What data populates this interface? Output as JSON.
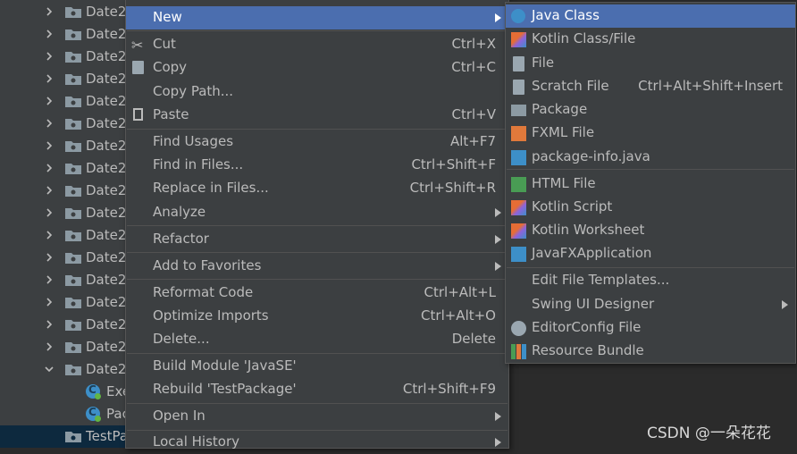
{
  "tree": {
    "rows": [
      {
        "label": "Date2"
      },
      {
        "label": "Date2"
      },
      {
        "label": "Date2"
      },
      {
        "label": "Date2"
      },
      {
        "label": "Date2"
      },
      {
        "label": "Date2"
      },
      {
        "label": "Date2"
      },
      {
        "label": "Date2"
      },
      {
        "label": "Date2"
      },
      {
        "label": "Date2"
      },
      {
        "label": "Date2"
      },
      {
        "label": "Date2"
      },
      {
        "label": "Date2"
      },
      {
        "label": "Date2"
      },
      {
        "label": "Date2"
      },
      {
        "label": "Date2"
      },
      {
        "label": "Date2"
      }
    ],
    "files": [
      {
        "label": "Exe"
      },
      {
        "label": "Pac"
      }
    ],
    "selected_label": "TestPa"
  },
  "main_menu": {
    "new": "New",
    "cut": "Cut",
    "cut_sc": "Ctrl+X",
    "copy": "Copy",
    "copy_sc": "Ctrl+C",
    "copy_path": "Copy Path...",
    "paste": "Paste",
    "paste_sc": "Ctrl+V",
    "find_usages": "Find Usages",
    "find_usages_sc": "Alt+F7",
    "find_in_files": "Find in Files...",
    "find_in_files_sc": "Ctrl+Shift+F",
    "replace_in_files": "Replace in Files...",
    "replace_in_files_sc": "Ctrl+Shift+R",
    "analyze": "Analyze",
    "refactor": "Refactor",
    "add_to_favorites": "Add to Favorites",
    "reformat_code": "Reformat Code",
    "reformat_code_sc": "Ctrl+Alt+L",
    "optimize_imports": "Optimize Imports",
    "optimize_imports_sc": "Ctrl+Alt+O",
    "delete": "Delete...",
    "delete_sc": "Delete",
    "build_module": "Build Module 'JavaSE'",
    "rebuild": "Rebuild 'TestPackage'",
    "rebuild_sc": "Ctrl+Shift+F9",
    "open_in": "Open In",
    "local_history": "Local History"
  },
  "sub_menu": {
    "java_class": "Java Class",
    "kotlin_class": "Kotlin Class/File",
    "file": "File",
    "scratch_file": "Scratch File",
    "scratch_file_sc": "Ctrl+Alt+Shift+Insert",
    "package": "Package",
    "fxml_file": "FXML File",
    "package_info": "package-info.java",
    "html_file": "HTML File",
    "kotlin_script": "Kotlin Script",
    "kotlin_worksheet": "Kotlin Worksheet",
    "javafx_app": "JavaFXApplication",
    "edit_templates": "Edit File Templates...",
    "swing_designer": "Swing UI Designer",
    "editorconfig": "EditorConfig File",
    "resource_bundle": "Resource Bundle"
  },
  "watermark": "CSDN @一朵花花",
  "colors": {
    "highlight": "#4b6eaf",
    "menu_bg": "#3c3f41",
    "tree_selected": "#0d293e"
  }
}
